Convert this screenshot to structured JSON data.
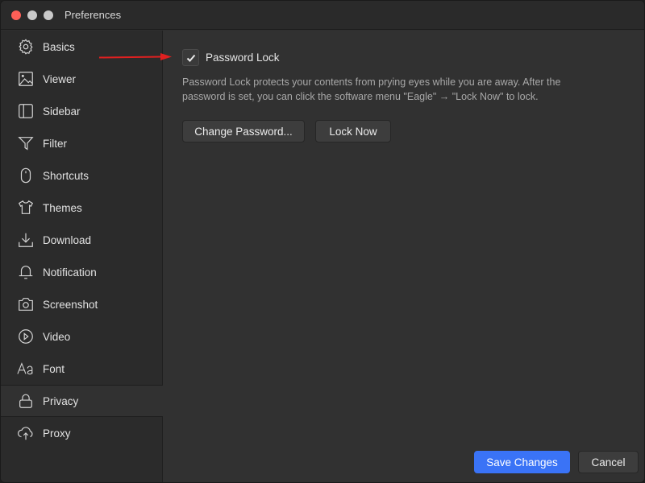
{
  "window": {
    "title": "Preferences"
  },
  "sidebar": {
    "items": [
      {
        "label": "Basics",
        "icon": "gear-icon",
        "active": false
      },
      {
        "label": "Viewer",
        "icon": "image-icon",
        "active": false
      },
      {
        "label": "Sidebar",
        "icon": "sidebar-icon",
        "active": false
      },
      {
        "label": "Filter",
        "icon": "filter-icon",
        "active": false
      },
      {
        "label": "Shortcuts",
        "icon": "mouse-icon",
        "active": false
      },
      {
        "label": "Themes",
        "icon": "tshirt-icon",
        "active": false
      },
      {
        "label": "Download",
        "icon": "download-icon",
        "active": false
      },
      {
        "label": "Notification",
        "icon": "bell-icon",
        "active": false
      },
      {
        "label": "Screenshot",
        "icon": "camera-icon",
        "active": false
      },
      {
        "label": "Video",
        "icon": "play-circle-icon",
        "active": false
      },
      {
        "label": "Font",
        "icon": "font-icon",
        "active": false
      },
      {
        "label": "Privacy",
        "icon": "lock-icon",
        "active": true
      },
      {
        "label": "Proxy",
        "icon": "cloud-upload-icon",
        "active": false
      }
    ]
  },
  "privacy": {
    "password_lock_label": "Password Lock",
    "password_lock_checked": true,
    "description": "Password Lock protects your contents from prying eyes while you are away. After the password is set, you can click the software menu \"Eagle\" → \"Lock Now\" to lock.",
    "change_password_label": "Change Password...",
    "lock_now_label": "Lock Now"
  },
  "footer": {
    "save_label": "Save Changes",
    "cancel_label": "Cancel"
  },
  "colors": {
    "accent": "#3a73f6",
    "annotation_arrow": "#e02020",
    "close": "#fe5f57"
  }
}
